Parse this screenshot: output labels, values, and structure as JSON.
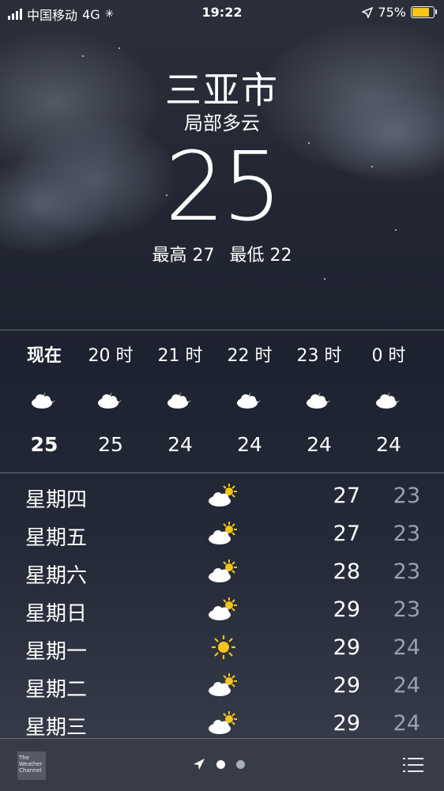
{
  "status_bar": {
    "carrier": "中国移动",
    "network": "4G",
    "time": "19:22",
    "battery": "75%",
    "battery_level": 0.75
  },
  "location": {
    "city": "三亚市",
    "condition": "局部多云",
    "temperature": "25",
    "high": "最高 27",
    "low": "最低 22"
  },
  "hourly": [
    {
      "hour": "现在",
      "icon": "partly-cloudy-night-icon",
      "temp": "25",
      "bold": true
    },
    {
      "hour": "20 时",
      "icon": "partly-cloudy-night-icon",
      "temp": "25"
    },
    {
      "hour": "21 时",
      "icon": "partly-cloudy-night-icon",
      "temp": "24"
    },
    {
      "hour": "22 时",
      "icon": "partly-cloudy-night-icon",
      "temp": "24"
    },
    {
      "hour": "23 时",
      "icon": "partly-cloudy-night-icon",
      "temp": "24"
    },
    {
      "hour": "0 时",
      "icon": "partly-cloudy-night-icon",
      "temp": "24"
    }
  ],
  "daily": [
    {
      "day": "星期四",
      "icon": "partly-sunny-icon",
      "high": "27",
      "low": "23"
    },
    {
      "day": "星期五",
      "icon": "partly-sunny-icon",
      "high": "27",
      "low": "23"
    },
    {
      "day": "星期六",
      "icon": "partly-sunny-icon",
      "high": "28",
      "low": "23"
    },
    {
      "day": "星期日",
      "icon": "partly-sunny-icon",
      "high": "29",
      "low": "23"
    },
    {
      "day": "星期一",
      "icon": "sunny-icon",
      "high": "29",
      "low": "24"
    },
    {
      "day": "星期二",
      "icon": "partly-sunny-icon",
      "high": "29",
      "low": "24"
    },
    {
      "day": "星期三",
      "icon": "partly-sunny-icon",
      "high": "29",
      "low": "24"
    }
  ],
  "bottom_bar": {
    "logo_text": "The Weather Channel",
    "page_count": 2,
    "current_page": 1
  },
  "colors": {
    "battery_fill": "#f5c518",
    "sun": "#f5c518",
    "low_temp": "#9aa0ad"
  }
}
